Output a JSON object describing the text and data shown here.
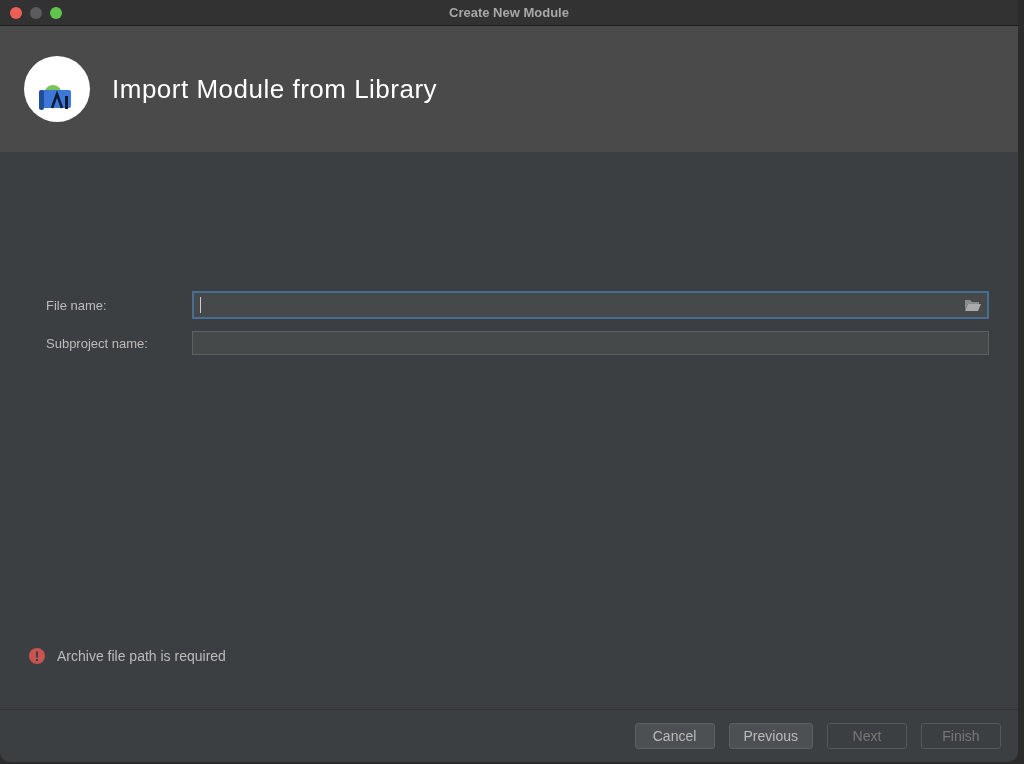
{
  "window": {
    "title": "Create New Module"
  },
  "header": {
    "title": "Import Module from Library"
  },
  "fields": [
    {
      "label": "File name:",
      "focused": true,
      "kind": "file"
    },
    {
      "label": "Subproject name:",
      "focused": false,
      "kind": "text"
    }
  ],
  "error": {
    "message": "Archive file path is required"
  },
  "buttons": [
    {
      "label": "Cancel",
      "disabled": false
    },
    {
      "label": "Previous",
      "disabled": false
    },
    {
      "label": "Next",
      "disabled": true
    },
    {
      "label": "Finish",
      "disabled": true
    }
  ]
}
